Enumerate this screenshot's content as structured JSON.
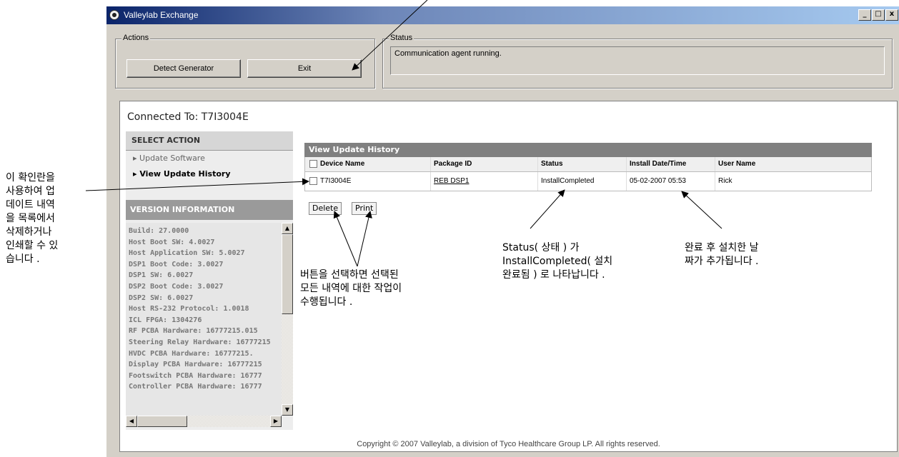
{
  "window": {
    "title": "Valleylab Exchange",
    "caption_buttons": [
      "_",
      "□",
      "x"
    ]
  },
  "actions": {
    "legend": "Actions",
    "detect_label": "Detect Generator",
    "exit_label": "Exit"
  },
  "status": {
    "legend": "Status",
    "text": "Communication agent running."
  },
  "connected": "Connected To: T7I3004E",
  "sidebar": {
    "select_action_header": "SELECT ACTION",
    "items": [
      {
        "label": "Update Software"
      },
      {
        "label": "View Update History"
      }
    ],
    "version_header": "VERSION INFORMATION",
    "version_lines": [
      "Build: 27.0000",
      "Host Boot SW: 4.0027",
      "Host Application SW: 5.0027",
      "DSP1 Boot Code: 3.0027",
      "DSP1 SW: 6.0027",
      "DSP2 Boot Code: 3.0027",
      "DSP2 SW: 6.0027",
      "Host RS-232 Protocol: 1.0018",
      "ICL FPGA: 1304276",
      "RF PCBA Hardware: 16777215.015",
      "Steering Relay Hardware: 16777215",
      "HVDC PCBA Hardware: 16777215.",
      "Display PCBA Hardware: 16777215",
      "Footswitch PCBA Hardware: 16777",
      "Controller PCBA Hardware: 16777"
    ]
  },
  "history": {
    "title": "View Update History",
    "columns": [
      "Device Name",
      "Package ID",
      "Status",
      "Install Date/Time",
      "User Name"
    ],
    "rows": [
      {
        "device": "T7I3004E",
        "package": "REB DSP1",
        "status": "InstallCompleted",
        "date": "05-02-2007 05:53",
        "user": "Rick"
      }
    ],
    "delete_label": "Delete",
    "print_label": "Print"
  },
  "copyright": "Copyright © 2007 Valleylab, a division of Tyco Healthcare Group LP. All rights reserved.",
  "annotations": {
    "left": [
      "이 확인란을",
      "사용하여 업",
      "데이트 내역",
      "을 목록에서",
      "삭제하거나",
      "인쇄할 수 있",
      "습니다 ."
    ],
    "buttons": [
      "버튼을 선택하면 선택된",
      "모든 내역에 대한 작업이",
      "수행됩니다 ."
    ],
    "status": [
      "Status( 상태 ) 가",
      "InstallCompleted( 설치",
      "완료됨 ) 로 나타납니다 ."
    ],
    "date": [
      "완료 후 설치한 날",
      "짜가 추가됩니다 ."
    ]
  }
}
